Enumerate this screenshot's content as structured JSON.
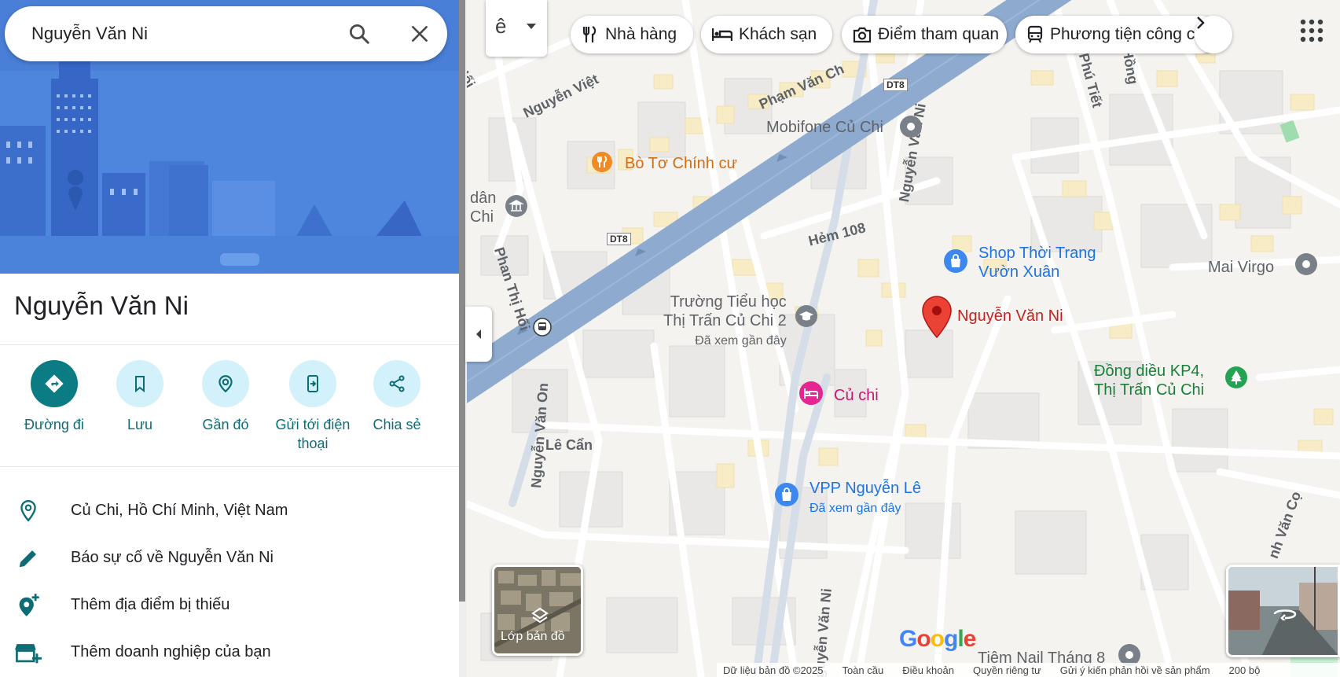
{
  "search": {
    "value": "Nguyễn Văn Ni",
    "search_label": "Tìm kiếm",
    "close_label": "Đóng"
  },
  "place": {
    "title": "Nguyễn Văn Ni"
  },
  "actions": [
    {
      "label": "Đường đi"
    },
    {
      "label": "Lưu"
    },
    {
      "label": "Gần đó"
    },
    {
      "label_line1": "Gửi tới điện",
      "label_line2": "thoại"
    },
    {
      "label": "Chia sẻ"
    }
  ],
  "info": [
    {
      "text": "Củ Chi, Hồ Chí Minh, Việt Nam",
      "icon": "location-pin-icon"
    },
    {
      "text": "Báo sự cố về Nguyễn Văn Ni",
      "icon": "pencil-icon"
    },
    {
      "text": "Thêm địa điểm bị thiếu",
      "icon": "add-location-icon"
    },
    {
      "text": "Thêm doanh nghiệp của bạn",
      "icon": "add-business-icon"
    }
  ],
  "chips": [
    {
      "label": "Nhà hàng",
      "icon": "restaurant-icon"
    },
    {
      "label": "Khách sạn",
      "icon": "hotel-icon"
    },
    {
      "label": "Điểm tham quan",
      "icon": "camera-icon"
    },
    {
      "label": "Phương tiện công c",
      "icon": "transit-icon"
    }
  ],
  "map": {
    "lang_glyph": "ê",
    "pois": {
      "bo_to": "Bò Tơ Chính cư",
      "mobifone": "Mobifone Củ Chi",
      "dan_line1": "dân",
      "dan_line2": "Chi",
      "shop_line1": "Shop Thời Trang",
      "shop_line2": "Vườn Xuân",
      "mai_virgo": "Mai Virgo",
      "truong_line1": "Trường Tiểu học",
      "truong_line2": "Thị Trấn Củ Chi 2",
      "truong_sub": "Đã xem gần đây",
      "selected": "Nguyễn Văn Ni",
      "dong_dieu_line1": "Đồng diều KP4,",
      "dong_dieu_line2": "Thị Trấn Củ Chi",
      "cu_chi": "Củ chi",
      "vpp": "VPP Nguyễn Lê",
      "vpp_sub": "Đã xem gần đây",
      "tiem_nail": "Tiệm Nail Tháng 8"
    },
    "streets": {
      "dt8_a": "DT8",
      "dt8_b": "DT8",
      "hem108": "Hẻm 108",
      "phan_thi_hoi": "Phan Thị Hối",
      "nguyen_van_ni_top": "Nguyễn Văn Ni",
      "nguyen_van_ni_bottom": "guyễn Văn Ni",
      "nguyen_van_on": "Nguyễn Văn On",
      "le_can": "Lê Cẩn",
      "pham_van": "Phạm Văn Ch",
      "nguyen_viet": "Nguyễn Việt",
      "hoi": "Hối",
      "phu_tiet": "n Phú Tiết",
      "hong": "Hồng",
      "van_co": "nh Văn Cọ"
    },
    "layers_label": "Lớp bản đồ",
    "google_logo": "Google",
    "footer": [
      "Dữ liệu bản đồ ©2025",
      "Toàn cầu",
      "Điều khoản",
      "Quyền riêng tư",
      "Gửi ý kiến phản hồi về sản phẩm",
      "200 bộ"
    ]
  },
  "colors": {
    "accent": "#0b7b84",
    "action_bg": "#d3f1fb",
    "hero_bg": "#4f86dd",
    "pin": "#ea4335",
    "road_main": "#8eaacf"
  }
}
